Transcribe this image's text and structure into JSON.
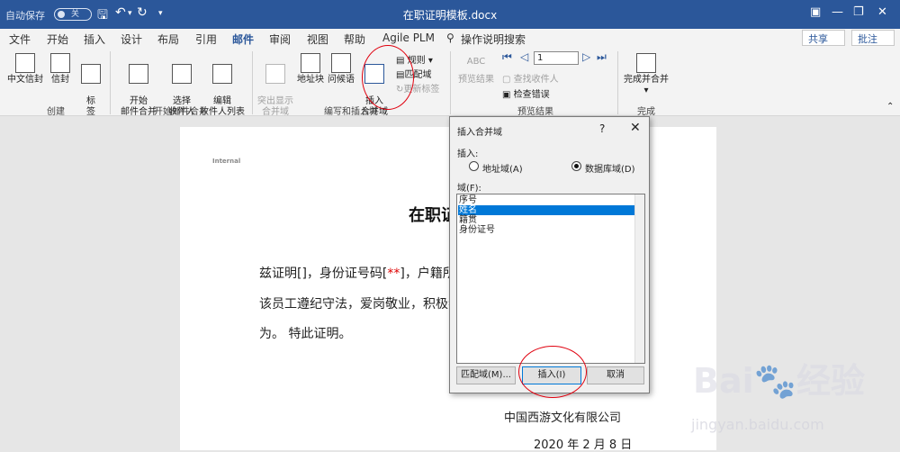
{
  "titlebar": {
    "autosave": "自动保存",
    "autosave_state": "关",
    "doc_title": "在职证明模板.docx"
  },
  "tabs": [
    "文件",
    "开始",
    "插入",
    "设计",
    "布局",
    "引用",
    "邮件",
    "审阅",
    "视图",
    "帮助",
    "Agile PLM"
  ],
  "active_tab": "邮件",
  "tell_me": "操作说明搜索",
  "share": "共享",
  "comment": "批注",
  "ribbon": {
    "create": {
      "label": "创建",
      "envelope_cn": "中文信封",
      "envelope": "信封",
      "labels": "标\n签"
    },
    "start_merge": {
      "label": "开始邮件合并",
      "start": "开始\n邮件合并",
      "select": "选择\n收件人",
      "edit": "编辑\n收件人列表"
    },
    "write_insert": {
      "label": "编写和插入域",
      "highlight": "突出显示\n合并域",
      "address": "地址块",
      "greeting": "问候语",
      "insert": "插入\n合并域",
      "rules": "规则",
      "match": "匹配域",
      "update": "更新标签"
    },
    "preview": {
      "label": "预览结果",
      "preview_btn": "预览结果",
      "find": "查找收件人",
      "check": "检查错误",
      "record": "1",
      "abc": "ABC"
    },
    "finish": {
      "label": "完成",
      "finish_btn": "完成并合并"
    }
  },
  "document": {
    "internal": "Internal",
    "heading": "在职证",
    "line1_a": "兹证明[]，身份证号码[",
    "line1_red": "**",
    "line1_b": "]，户籍所",
    "line2": "该员工遵纪守法，爱岗敬业，积极参",
    "line3": "为。 特此证明。",
    "company": "中国西游文化有限公司",
    "date": "2020 年 2 月 8 日"
  },
  "dialog": {
    "title": "插入合并域",
    "help": "?",
    "insert_label": "插入:",
    "radio_address": "地址域(A)",
    "radio_database": "数据库域(D)",
    "field_label": "域(F):",
    "fields": [
      "序号",
      "姓名",
      "籍贯",
      "身份证号"
    ],
    "selected_index": 1,
    "btn_match": "匹配域(M)...",
    "btn_insert": "插入(I)",
    "btn_cancel": "取消"
  },
  "watermark": {
    "brand": "Bai",
    "brand_cn": "经验",
    "url": "jingyan.baidu.com"
  },
  "colors": {
    "brand": "#2b579a",
    "selection": "#0078d7",
    "annotation": "#e0000e"
  }
}
